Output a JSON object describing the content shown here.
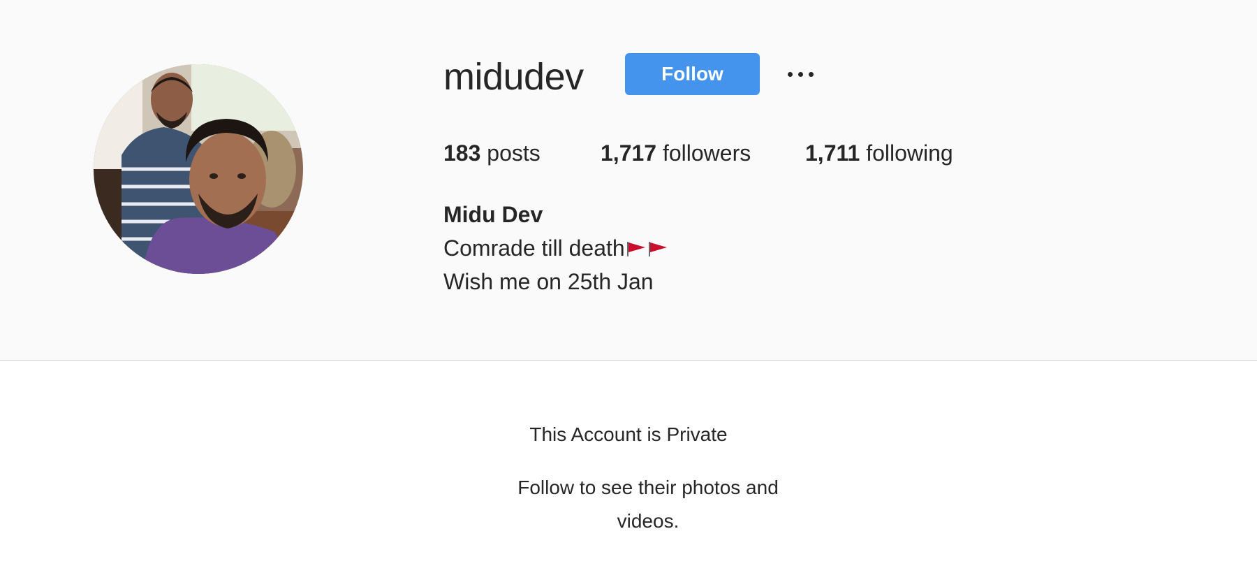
{
  "profile": {
    "username": "midudev",
    "follow_label": "Follow",
    "more_options_icon": "more-horizontal-icon",
    "avatar_alt": "profile photo",
    "stats": {
      "posts_count": "183",
      "posts_label": "posts",
      "followers_count": "1,717",
      "followers_label": "followers",
      "following_count": "1,711",
      "following_label": "following"
    },
    "bio": {
      "full_name": "Midu Dev",
      "line1": "Comrade till death",
      "line2": "Wish me on 25th Jan"
    }
  },
  "private_notice": {
    "title": "This Account is Private",
    "subtitle": "Follow to see their photos and videos."
  },
  "colors": {
    "follow_button": "#4494ee",
    "header_background": "#fafafa",
    "text": "#262626",
    "flag": "#c8102e"
  }
}
